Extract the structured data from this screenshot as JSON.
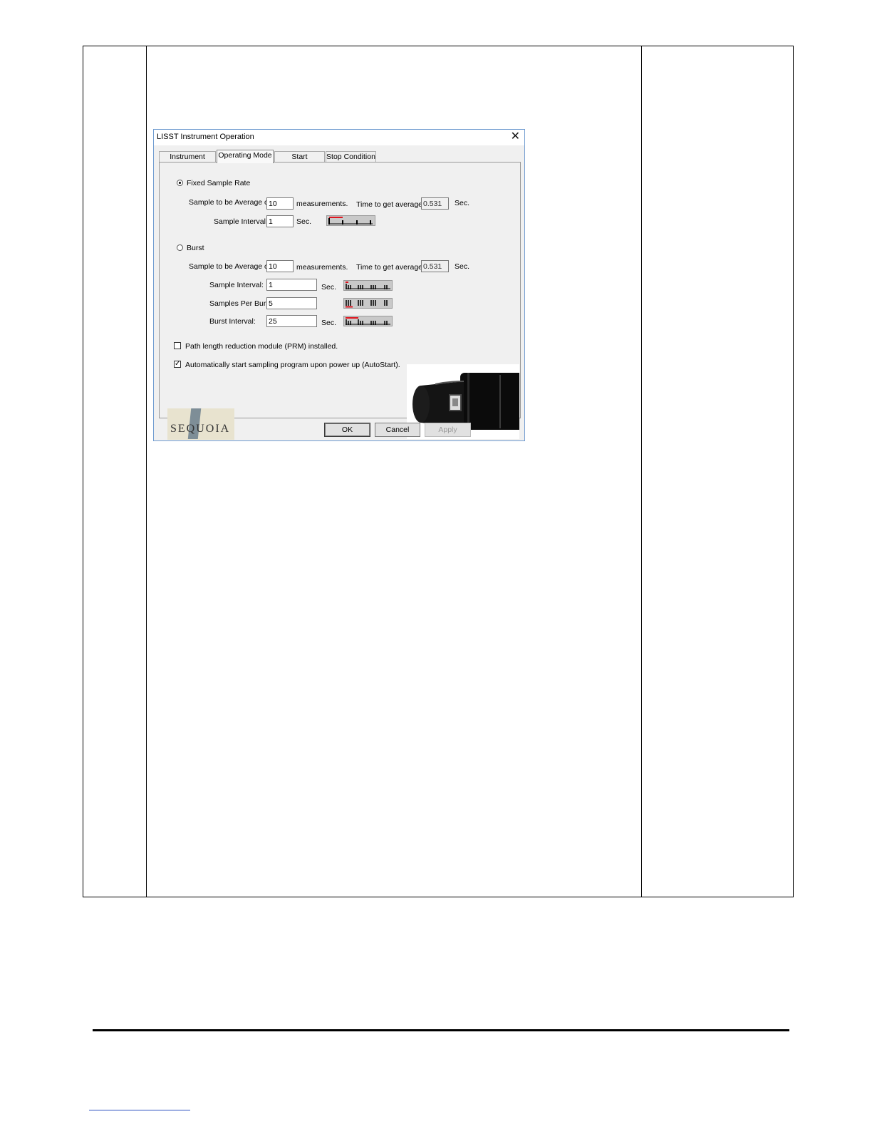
{
  "dialog": {
    "title": "LISST Instrument Operation",
    "tabs": [
      {
        "label": "Instrument Status"
      },
      {
        "label": "Operating Mode"
      },
      {
        "label": "Start Condition"
      },
      {
        "label": "Stop Condition"
      }
    ],
    "active_tab": "Operating Mode",
    "fixed": {
      "radio_label": "Fixed Sample Rate",
      "selected": true,
      "avg_label": "Sample to be Average of",
      "avg_value": "10",
      "measurements_label": "measurements.",
      "time_label": "Time to get average:",
      "time_value": "0.531",
      "time_unit": "Sec.",
      "interval_label": "Sample Interval:",
      "interval_value": "1",
      "interval_unit": "Sec."
    },
    "burst": {
      "radio_label": "Burst",
      "selected": false,
      "avg_label": "Sample to be Average of",
      "avg_value": "10",
      "measurements_label": "measurements.",
      "time_label": "Time to get average:",
      "time_value": "0.531",
      "time_unit": "Sec.",
      "interval_label": "Sample Interval:",
      "interval_value": "1",
      "interval_unit": "Sec.",
      "per_burst_label": "Samples Per Burst:",
      "per_burst_value": "5",
      "burst_interval_label": "Burst Interval:",
      "burst_interval_value": "25",
      "burst_interval_unit": "Sec."
    },
    "options": {
      "prm_label": "Path length reduction module (PRM) installed.",
      "prm_checked": false,
      "autostart_label": "Automatically start sampling program upon power up (AutoStart).",
      "autostart_checked": true
    },
    "logo_text": "SEQUOIA",
    "buttons": {
      "ok": "OK",
      "cancel": "Cancel",
      "apply": "Apply"
    }
  },
  "colors": {
    "dialog_border": "#6f9bd0",
    "marker_red": "#e0141e",
    "dialog_bg": "#f0f0f0"
  }
}
